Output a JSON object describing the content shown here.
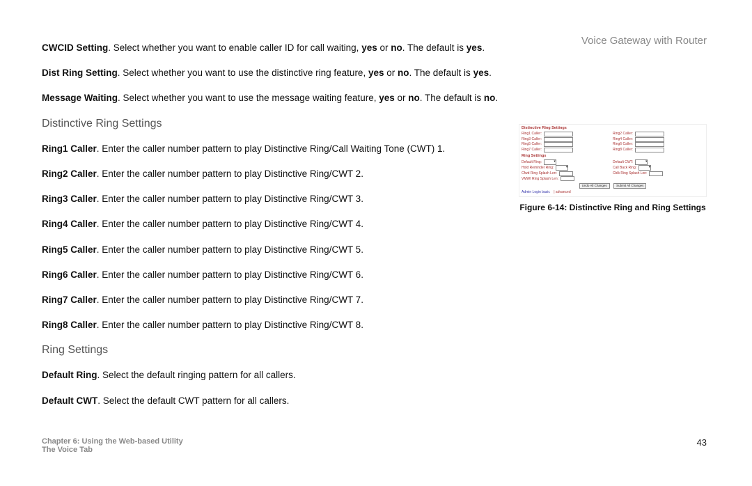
{
  "header": {
    "title": "Voice Gateway with Router"
  },
  "paragraphs": {
    "cwcid_setting_bold": "CWCID Setting",
    "cwcid_setting_rest": ". Select whether you want to enable caller ID for call waiting, ",
    "cwcid_yes": "yes",
    "cwcid_or": " or ",
    "cwcid_no": "no",
    "cwcid_tail": ". The default is ",
    "cwcid_default": "yes",
    "cwcid_dot": ".",
    "dist_bold": "Dist Ring Setting",
    "dist_rest": ". Select whether you want to use the distinctive ring feature, ",
    "dist_yes": "yes",
    "dist_or": " or ",
    "dist_no": "no",
    "dist_tail": ". The default is ",
    "dist_default": "yes",
    "dist_dot": ".",
    "mw_bold": "Message Waiting",
    "mw_rest": ". Select whether you want to use the message waiting feature, ",
    "mw_yes": "yes",
    "mw_or": " or ",
    "mw_no": "no",
    "mw_tail": ". The default is ",
    "mw_default": "no",
    "mw_dot": "."
  },
  "sections": {
    "distinctive": "Distinctive Ring Settings",
    "ringsettings": "Ring Settings"
  },
  "rings": {
    "r1_b": "Ring1 Caller",
    "r1": ". Enter the caller number pattern to play Distinctive Ring/Call Waiting Tone (CWT) 1.",
    "r2_b": "Ring2 Caller",
    "r2": ". Enter the caller number pattern to play Distinctive Ring/CWT 2.",
    "r3_b": "Ring3 Caller",
    "r3": ". Enter the caller number pattern to play Distinctive Ring/CWT 3.",
    "r4_b": "Ring4 Caller",
    "r4": ". Enter the caller number pattern to play Distinctive Ring/CWT 4.",
    "r5_b": "Ring5 Caller",
    "r5": ". Enter the caller number pattern to play Distinctive Ring/CWT 5.",
    "r6_b": "Ring6 Caller",
    "r6": ". Enter the caller number pattern to play Distinctive Ring/CWT 6.",
    "r7_b": "Ring7 Caller",
    "r7": ". Enter the caller number pattern to play Distinctive Ring/CWT 7.",
    "r8_b": "Ring8 Caller",
    "r8": ". Enter the caller number pattern to play Distinctive Ring/CWT 8.",
    "dr_b": "Default Ring",
    "dr": ". Select the default ringing pattern for all callers.",
    "dc_b": "Default CWT",
    "dc": ". Select the default CWT pattern for all callers."
  },
  "figure": {
    "section1": "Distinctive Ring Settings",
    "row_labels": [
      "Ring1 Caller:",
      "Ring2 Caller:",
      "Ring3 Caller:",
      "Ring4 Caller:",
      "Ring5 Caller:",
      "Ring6 Caller:",
      "Ring7 Caller:",
      "Ring8 Caller:"
    ],
    "section2": "Ring Settings",
    "rs_rows": [
      {
        "l1": "Default Ring:",
        "l2": "Default CWT:",
        "type": "select"
      },
      {
        "l1": "Hold Reminder Ring:",
        "l2": "Call Back Ring:",
        "type": "select"
      },
      {
        "l1": "Cfwd Ring Splash Len:",
        "l2": "Cblk Ring Splash Len:",
        "type": "input"
      },
      {
        "l1": "VMWI Ring Splash Len:",
        "l2": "",
        "type": "input"
      }
    ],
    "btn1": "Undo All Changes",
    "btn2": "Submit All Changes",
    "links": "Admin Login   basic",
    "links_sep": " | advanced",
    "caption": "Figure 6-14: Distinctive Ring and Ring Settings"
  },
  "footer": {
    "line1": "Chapter 6: Using the Web-based Utility",
    "line2": "The Voice Tab",
    "page": "43"
  }
}
